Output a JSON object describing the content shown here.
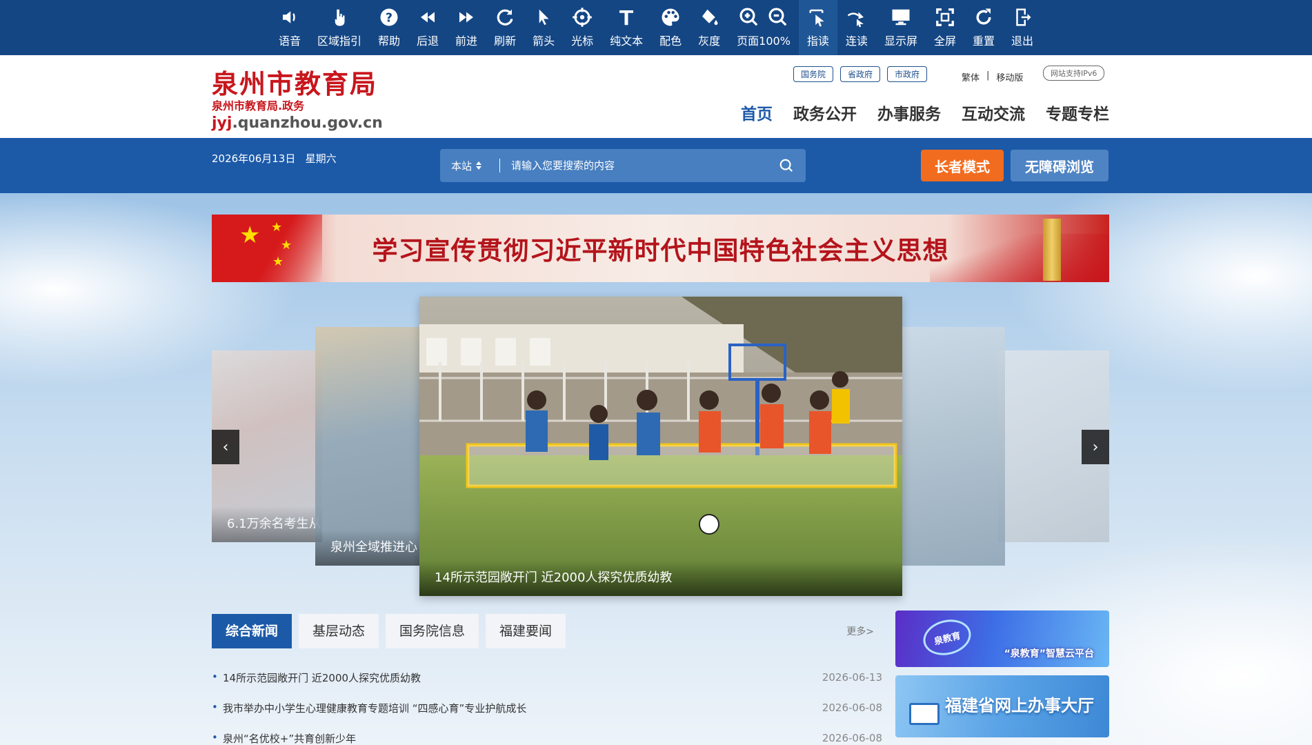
{
  "toolbar": {
    "items": [
      {
        "label": "语音",
        "icon": "speaker-icon"
      },
      {
        "label": "区域指引",
        "icon": "hand-pointer-icon"
      },
      {
        "label": "帮助",
        "icon": "help-icon"
      },
      {
        "label": "后退",
        "icon": "rewind-icon"
      },
      {
        "label": "前进",
        "icon": "fast-forward-icon"
      },
      {
        "label": "刷新",
        "icon": "refresh-icon"
      },
      {
        "label": "箭头",
        "icon": "arrow-cursor-icon"
      },
      {
        "label": "光标",
        "icon": "crosshair-icon"
      },
      {
        "label": "纯文本",
        "icon": "text-icon"
      },
      {
        "label": "配色",
        "icon": "palette-icon"
      },
      {
        "label": "灰度",
        "icon": "paint-bucket-icon"
      },
      {
        "label": "页面100%",
        "icon": "zoom-icon"
      },
      {
        "label": "指读",
        "icon": "point-read-icon"
      },
      {
        "label": "连读",
        "icon": "continuous-read-icon"
      },
      {
        "label": "显示屏",
        "icon": "monitor-icon"
      },
      {
        "label": "全屏",
        "icon": "fullscreen-icon"
      },
      {
        "label": "重置",
        "icon": "reset-icon"
      },
      {
        "label": "退出",
        "icon": "exit-icon"
      }
    ],
    "active_label": "指读"
  },
  "header": {
    "logo_title": "泉州市教育局",
    "logo_subtitle": "泉州市教育局.政务",
    "logo_domain_prefix": "jyj",
    "logo_domain_rest": ".quanzhou.gov.cn",
    "gov_links": [
      "国务院",
      "省政府",
      "市政府"
    ],
    "traditional": "繁体",
    "separator": "|",
    "mobile": "移动版",
    "ipv6": "网站支持IPv6",
    "nav": [
      "首页",
      "政务公开",
      "办事服务",
      "互动交流",
      "专题专栏"
    ]
  },
  "band": {
    "date": "2026年06月13日",
    "weekday": "星期六",
    "search_scope": "本站",
    "search_placeholder": "请输入您要搜索的内容",
    "elder_mode": "长者模式",
    "accessible": "无障碍浏览"
  },
  "banner": {
    "text": "学习宣传贯彻习近平新时代中国特色社会主义思想"
  },
  "carousel": {
    "far_left_caption": "6.1万余名考生从",
    "left_caption": "泉州全域推进心",
    "center_caption": "14所示范园敞开门 近2000人探究优质幼教",
    "prev": "‹",
    "next": "›"
  },
  "news": {
    "tabs": [
      "综合新闻",
      "基层动态",
      "国务院信息",
      "福建要闻"
    ],
    "more": "更多>",
    "items": [
      {
        "title": "14所示范园敞开门 近2000人探究优质幼教",
        "date": "2026-06-13"
      },
      {
        "title": "我市举办中小学生心理健康教育专题培训 “四感心育”专业护航成长",
        "date": "2026-06-08"
      },
      {
        "title": "泉州“名优校+”共育创新少年",
        "date": "2026-06-08"
      }
    ]
  },
  "promos": {
    "promo1_badge": "泉教育",
    "promo1_text": "“泉教育”智慧云平台",
    "promo2_text": "福建省网上办事大厅"
  },
  "colors": {
    "toolbar_bg": "#144684",
    "band_bg": "#1c5aa8",
    "brand_red": "#c8161d",
    "elder_btn": "#f26c1f",
    "access_btn": "#4f84c4"
  }
}
